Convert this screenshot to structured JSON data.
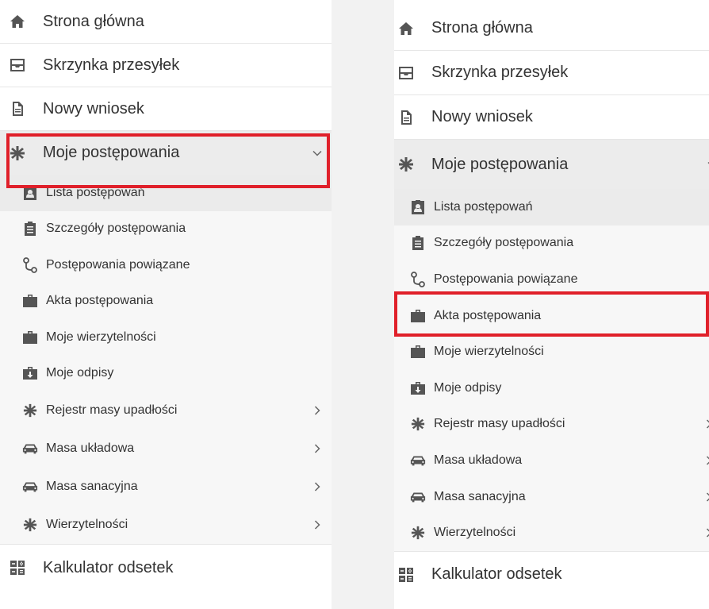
{
  "left": {
    "top_items": [
      {
        "label": "Strona główna",
        "icon": "home-icon"
      },
      {
        "label": "Skrzynka przesyłek",
        "icon": "inbox-icon"
      },
      {
        "label": "Nowy wniosek",
        "icon": "document-icon"
      }
    ],
    "active_item": {
      "label": "Moje postępowania",
      "icon": "asterisk-icon",
      "expanded": true
    },
    "sub_items": [
      {
        "label": "Lista postępowań",
        "icon": "id-badge-icon",
        "selected": true
      },
      {
        "label": "Szczegóły postępowania",
        "icon": "clipboard-icon"
      },
      {
        "label": "Postępowania powiązane",
        "icon": "link-route-icon"
      },
      {
        "label": "Akta postępowania",
        "icon": "briefcase-icon"
      },
      {
        "label": "Moje wierzytelności",
        "icon": "briefcase-icon"
      },
      {
        "label": "Moje odpisy",
        "icon": "briefcase-download-icon"
      },
      {
        "label": "Rejestr masy upadłości",
        "icon": "asterisk-icon",
        "has_children": true
      },
      {
        "label": "Masa układowa",
        "icon": "car-icon",
        "has_children": true
      },
      {
        "label": "Masa sanacyjna",
        "icon": "car-icon",
        "has_children": true
      },
      {
        "label": "Wierzytelności",
        "icon": "asterisk-icon",
        "has_children": true
      }
    ],
    "bottom_item": {
      "label": "Kalkulator odsetek",
      "icon": "calculator-icon"
    }
  },
  "right": {
    "top_items": [
      {
        "label": "Strona główna",
        "icon": "home-icon"
      },
      {
        "label": "Skrzynka przesyłek",
        "icon": "inbox-icon"
      },
      {
        "label": "Nowy wniosek",
        "icon": "document-icon"
      }
    ],
    "active_item": {
      "label": "Moje postępowania",
      "icon": "asterisk-icon",
      "expanded": true
    },
    "sub_items": [
      {
        "label": "Lista postępowań",
        "icon": "id-badge-icon",
        "selected": true
      },
      {
        "label": "Szczegóły postępowania",
        "icon": "clipboard-icon"
      },
      {
        "label": "Postępowania powiązane",
        "icon": "link-route-icon"
      },
      {
        "label": "Akta postępowania",
        "icon": "briefcase-icon",
        "highlighted": true
      },
      {
        "label": "Moje wierzytelności",
        "icon": "briefcase-icon"
      },
      {
        "label": "Moje odpisy",
        "icon": "briefcase-download-icon"
      },
      {
        "label": "Rejestr masy upadłości",
        "icon": "asterisk-icon",
        "has_children": true
      },
      {
        "label": "Masa układowa",
        "icon": "car-icon",
        "has_children": true
      },
      {
        "label": "Masa sanacyjna",
        "icon": "car-icon",
        "has_children": true
      },
      {
        "label": "Wierzytelności",
        "icon": "asterisk-icon",
        "has_children": true
      }
    ],
    "bottom_item": {
      "label": "Kalkulator odsetek",
      "icon": "calculator-icon"
    }
  },
  "colors": {
    "highlight": "#e0202a",
    "selected_bg": "#ebebeb",
    "submenu_bg": "#f7f7f7"
  }
}
